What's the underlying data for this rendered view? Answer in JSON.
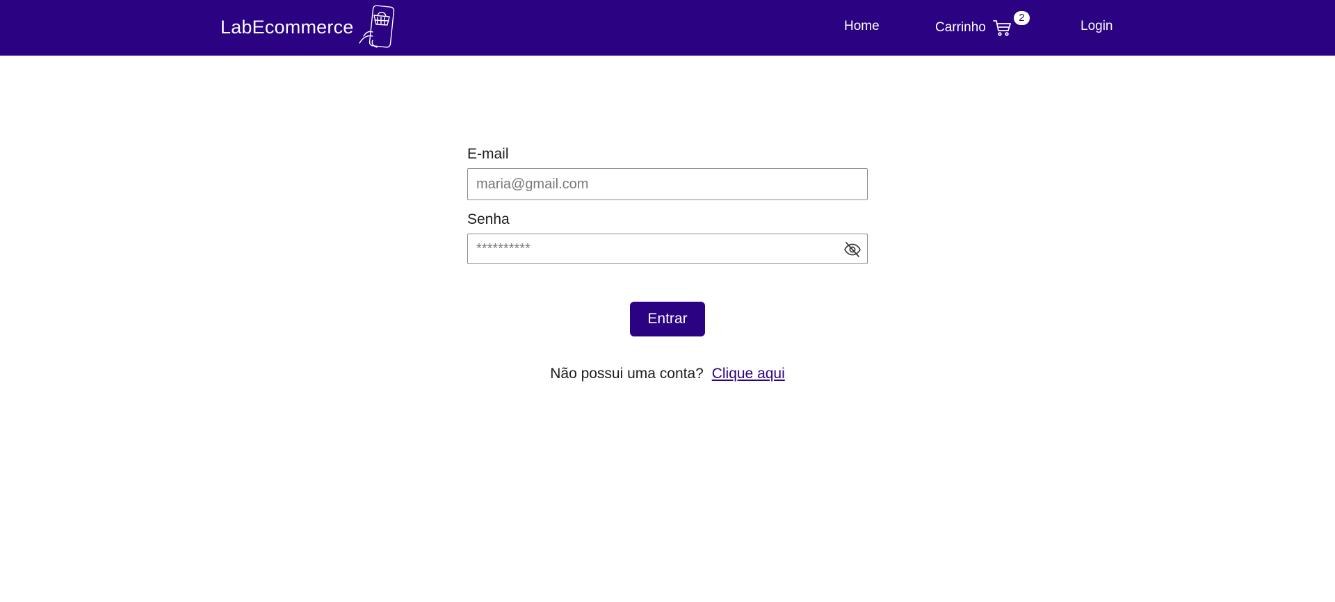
{
  "header": {
    "brand": "LabEcommerce",
    "brand_logo_icon": "phone-shopping-basket-icon",
    "background": "#2a0282",
    "nav": {
      "home_label": "Home",
      "cart_label": "Carrinho",
      "cart_icon": "shopping-cart-icon",
      "cart_count": "2",
      "login_label": "Login"
    }
  },
  "form": {
    "email_label": "E-mail",
    "email_placeholder": "maria@gmail.com",
    "email_value": "",
    "password_label": "Senha",
    "password_placeholder": "**********",
    "password_value": "",
    "password_toggle_icon": "eye-off-icon",
    "submit_label": "Entrar",
    "signup_prompt": "Não possui uma conta?",
    "signup_link": "Clique aqui"
  },
  "colors": {
    "accent": "#2a0282",
    "text": "#1d1d1d",
    "placeholder": "#7a7a7a",
    "border": "#8a8a8a"
  }
}
